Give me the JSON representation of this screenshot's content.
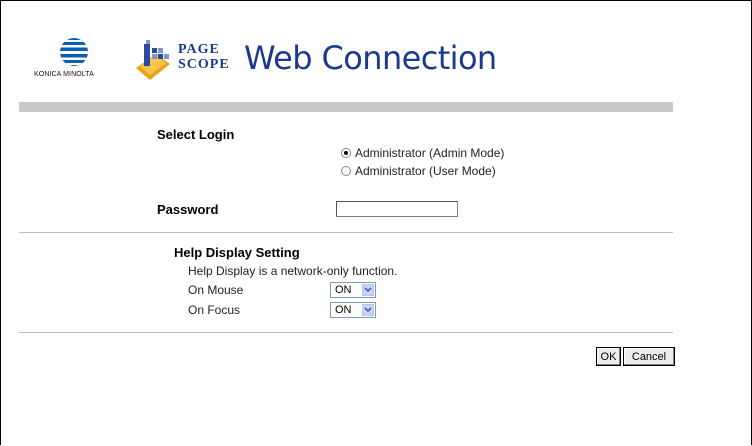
{
  "header": {
    "brand_text": "KONICA MINOLTA",
    "product_line1": "PAGE",
    "product_line2": "SCOPE",
    "product_title": "Web Connection"
  },
  "login": {
    "section_label": "Select Login",
    "options": [
      {
        "label": "Administrator (Admin Mode)",
        "checked": true
      },
      {
        "label": "Administrator (User Mode)",
        "checked": false
      }
    ]
  },
  "password": {
    "label": "Password",
    "value": ""
  },
  "help": {
    "title": "Help Display Setting",
    "description": "Help Display is a network-only function.",
    "on_mouse_label": "On Mouse",
    "on_mouse_value": "ON",
    "on_focus_label": "On Focus",
    "on_focus_value": "ON"
  },
  "buttons": {
    "ok": "OK",
    "cancel": "Cancel"
  },
  "colors": {
    "brand_blue": "#1b3a8f",
    "bar_grey": "#c8c8c8"
  }
}
